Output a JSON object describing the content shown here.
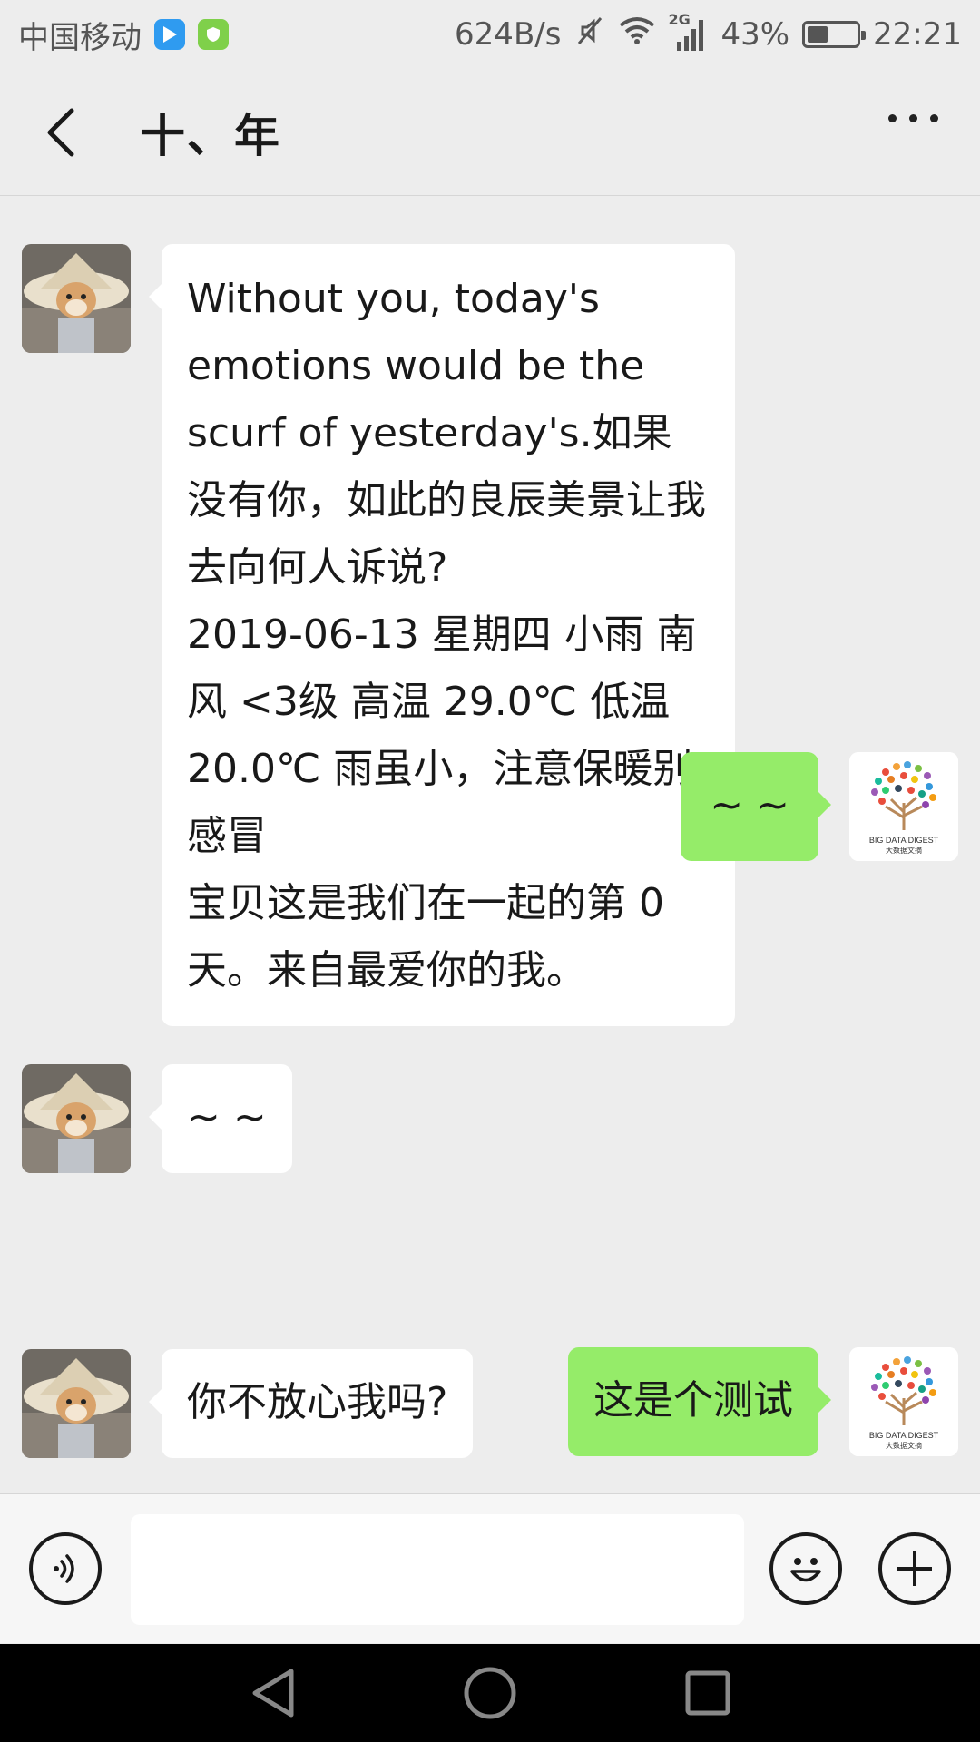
{
  "status_bar": {
    "carrier": "中国移动",
    "speed": "624B/s",
    "network": "2G",
    "battery_percent": "43%",
    "battery_level": 0.43,
    "time": "22:21"
  },
  "header": {
    "title": "十、年",
    "back_icon": "chevron-left-icon",
    "more_icon": "more-dots-icon"
  },
  "messages": [
    {
      "side": "in",
      "text": "Without you, today's emotions would be the scurf of yesterday's.如果没有你，如此的良辰美景让我去向何人诉说?\n2019-06-13 星期四 小雨 南风 <3级 高温 29.0℃ 低温 20.0℃ 雨虽小，注意保暖别感冒\n宝贝这是我们在一起的第 0 天。来自最爱你的我。"
    },
    {
      "side": "out",
      "text": "~ ~"
    },
    {
      "side": "in",
      "text": "~ ~"
    },
    {
      "side": "out",
      "text": "这是个测试"
    },
    {
      "side": "in",
      "text": "你不放心我吗?"
    }
  ],
  "self_avatar": {
    "logo_text_en": "BIG DATA DIGEST",
    "logo_text_cn": "大数据文摘"
  },
  "input_bar": {
    "placeholder": "",
    "voice_icon": "voice-icon",
    "emoji_icon": "emoji-icon",
    "plus_icon": "plus-icon"
  },
  "colors": {
    "background": "#ededed",
    "incoming_bubble": "#ffffff",
    "outgoing_bubble": "#95ec69"
  }
}
